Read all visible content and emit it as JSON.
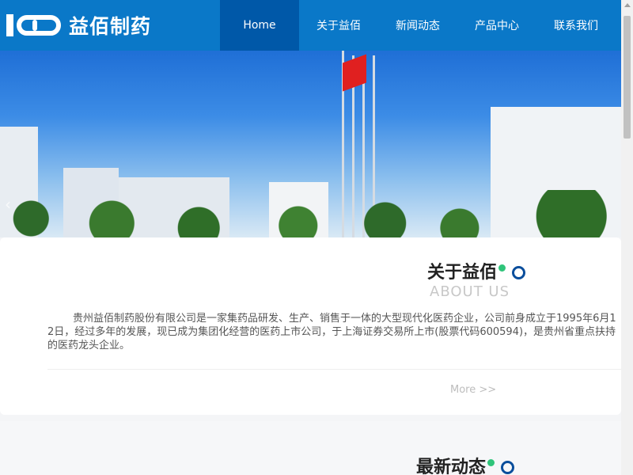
{
  "header": {
    "logo_mark": "100",
    "logo_text": "益佰制药",
    "nav": [
      {
        "label": "Home",
        "active": true
      },
      {
        "label": "关于益佰",
        "active": false
      },
      {
        "label": "新闻动态",
        "active": false
      },
      {
        "label": "产品中心",
        "active": false
      },
      {
        "label": "联系我们",
        "active": false
      }
    ]
  },
  "banner": {
    "arrow_left": "‹"
  },
  "about": {
    "title": "关于益佰",
    "subtitle": "ABOUT US",
    "text": "贵州益佰制药股份有限公司是一家集药品研发、生产、销售于一体的大型现代化医药企业，公司前身成立于1995年6月12日，经过多年的发展，现已成为集团化经营的医药上市公司，于上海证券交易所上市(股票代码600594)，是贵州省重点扶持的医药龙头企业。",
    "more": "More >>"
  },
  "news": {
    "title": "最新动态"
  },
  "colors": {
    "header_bg": "#0a78c8",
    "nav_active": "#0058a8",
    "accent_green": "#2fc47a",
    "accent_ring": "#0a4e9c"
  }
}
